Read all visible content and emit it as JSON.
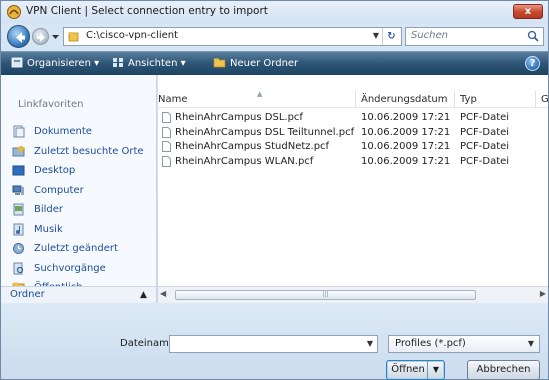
{
  "window": {
    "title": "VPN Client  |  Select connection entry to import",
    "close_label": "x"
  },
  "address": {
    "path": "C:\\cisco-vpn-client",
    "search_placeholder": "Suchen"
  },
  "toolbar": {
    "organize_label": "Organisieren",
    "views_label": "Ansichten",
    "new_folder_label": "Neuer Ordner",
    "help_label": "?"
  },
  "sidebar": {
    "header": "Linkfavoriten",
    "items": [
      {
        "label": "Dokumente",
        "icon": "documents-icon"
      },
      {
        "label": "Zuletzt besuchte Orte",
        "icon": "recent-places-icon"
      },
      {
        "label": "Desktop",
        "icon": "desktop-icon"
      },
      {
        "label": "Computer",
        "icon": "computer-icon"
      },
      {
        "label": "Bilder",
        "icon": "pictures-icon"
      },
      {
        "label": "Musik",
        "icon": "music-icon"
      },
      {
        "label": "Zuletzt geändert",
        "icon": "recently-changed-icon"
      },
      {
        "label": "Suchvorgänge",
        "icon": "searches-icon"
      },
      {
        "label": "Öffentlich",
        "icon": "public-folder-icon"
      }
    ],
    "folder_label": "Ordner"
  },
  "file_list": {
    "columns": [
      "Name",
      "Änderungsdatum",
      "Typ",
      "G"
    ],
    "rows": [
      {
        "name": "RheinAhrCampus DSL.pcf",
        "date": "10.06.2009 17:21",
        "type": "PCF-Datei"
      },
      {
        "name": "RheinAhrCampus DSL Teiltunnel.pcf",
        "date": "10.06.2009 17:21",
        "type": "PCF-Datei"
      },
      {
        "name": "RheinAhrCampus StudNetz.pcf",
        "date": "10.06.2009 17:21",
        "type": "PCF-Datei"
      },
      {
        "name": "RheinAhrCampus WLAN.pcf",
        "date": "10.06.2009 17:21",
        "type": "PCF-Datei"
      }
    ]
  },
  "bottom": {
    "filename_label": "Dateiname:",
    "filename_value": "",
    "filetype_value": "Profiles (*.pcf)",
    "open_label": "Öffnen",
    "cancel_label": "Abbrechen"
  }
}
